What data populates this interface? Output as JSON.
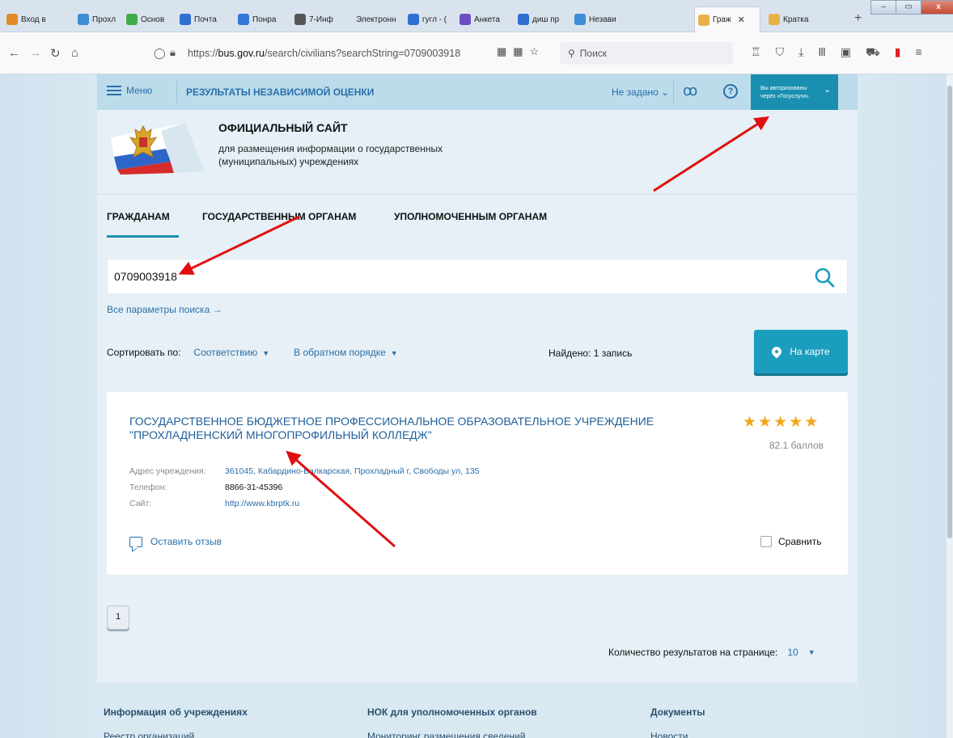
{
  "browser": {
    "tabs": [
      {
        "label": "Вход в",
        "color": "#e08a2a"
      },
      {
        "label": "Прохл",
        "color": "#3a8dd6"
      },
      {
        "label": "Основ",
        "color": "#3fae49"
      },
      {
        "label": "Почта",
        "color": "#2f6fd1"
      },
      {
        "label": "Понра",
        "color": "#2f78d8"
      },
      {
        "label": "7-Инф",
        "color": "#555555"
      },
      {
        "label": "Электронн",
        "color": "#d8e3ee"
      },
      {
        "label": "гугл - (",
        "color": "#2f6fd1"
      },
      {
        "label": "Анкета",
        "color": "#6a4fc4"
      },
      {
        "label": "диш пр",
        "color": "#2f6fd1"
      },
      {
        "label": "Незави",
        "color": "#3a8dd6"
      },
      {
        "label": "Граж",
        "color": "#e8b24a",
        "active": true
      },
      {
        "label": "Кратка",
        "color": "#e8b24a"
      }
    ],
    "new_tab": "+",
    "window_controls": [
      "–",
      "▭",
      "x"
    ],
    "url_prefix": "https://",
    "url_domain": "bus.gov.ru",
    "url_path": "/search/civilians?searchString=0709003918",
    "search_placeholder": "Поиск"
  },
  "site": {
    "menu_label": "Меню",
    "results_link": "РЕЗУЛЬТАТЫ НЕЗАВИСИМОЙ ОЦЕНКИ",
    "not_set": "Не задано",
    "auth_line1": "Вы авторизованы",
    "auth_line2": "через «Госуслуги»",
    "title": "ОФИЦИАЛЬНЫЙ САЙТ",
    "subtitle": "для размещения информации о государственных (муниципальных) учреждениях",
    "nav": [
      "ГРАЖДАНАМ",
      "ГОСУДАРСТВЕННЫМ ОРГАНАМ",
      "УПОЛНОМОЧЕННЫМ ОРГАНАМ"
    ]
  },
  "search": {
    "value": "0709003918",
    "all_params": "Все параметры поиска →"
  },
  "sort": {
    "label": "Сортировать по:",
    "option1": "Соответствию",
    "option2": "В обратном порядке",
    "found": "Найдено: 1 запись",
    "map_button": "На карте"
  },
  "result": {
    "name": "ГОСУДАРСТВЕННОЕ БЮДЖЕТНОЕ ПРОФЕССИОНАЛЬНОЕ ОБРАЗОВАТЕЛЬНОЕ УЧРЕЖДЕНИЕ \"ПРОХЛАДНЕНСКИЙ МНОГОПРОФИЛЬНЫЙ КОЛЛЕДЖ\"",
    "rating_stars": 5,
    "score": "82.1 баллов",
    "address_label": "Адрес учреждения:",
    "address": "361045, Кабардино-Балкарская, Прохладный г, Свободы ул, 135",
    "phone_label": "Телефон:",
    "phone": "8866-31-45396",
    "site_label": "Сайт:",
    "site": "http://www.kbrptk.ru",
    "review": "Оставить отзыв",
    "compare": "Сравнить"
  },
  "pagination": {
    "current_page": "1",
    "per_page_label": "Количество результатов на странице:",
    "per_page_value": "10"
  },
  "footer": {
    "col1_title": "Информация об учреждениях",
    "col1_item": "Реестр организаций",
    "col2_title": "НОК для уполномоченных органов",
    "col2_item": "Мониторинг размещения сведений",
    "col3_title": "Документы",
    "col3_item": "Новости"
  },
  "colors": {
    "accent": "#1b9dbd",
    "link": "#2a6fa8",
    "arrow": "#e01010",
    "star": "#f2a81d"
  }
}
